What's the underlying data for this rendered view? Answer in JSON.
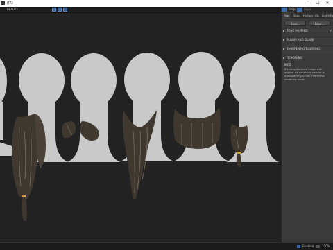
{
  "window": {
    "title": "(IR)",
    "minimize": "–",
    "maximize": "☐",
    "close": "✕"
  },
  "toolbar": {
    "mode_label": "BEAUTY",
    "buttons": [
      "view",
      "render",
      "compare"
    ]
  },
  "top_controls": {
    "stop_label": "Stop",
    "other_label": "Pipel"
  },
  "panel": {
    "tabs": [
      "Post",
      "Stats",
      "History",
      "IBL",
      "LightMix"
    ],
    "active_tab": "Post",
    "buttons": {
      "save": "Save...",
      "load": "Load..."
    },
    "sections": [
      {
        "label": "TONE MAPPING",
        "checked": true
      },
      {
        "label": "BLOOM AND GLARE",
        "checked": false
      },
      {
        "label": "SHARPENING/BLURRING",
        "checked": false
      },
      {
        "label": "DENOISING",
        "checked": false
      }
    ],
    "info": {
      "title": "INFO",
      "text": "Blending denoised image with original via denoising amount is available only in non interactive rendering mode"
    }
  },
  "statusbar": {
    "status": "Enabled",
    "zoom": "100%"
  },
  "colors": {
    "viewport_bg": "#222222",
    "head": "#c8c8c8",
    "hair": "#3f3a33",
    "hair_light": "#7a7063",
    "accent": "#3d6aa8",
    "gold": "#c9a23a"
  }
}
